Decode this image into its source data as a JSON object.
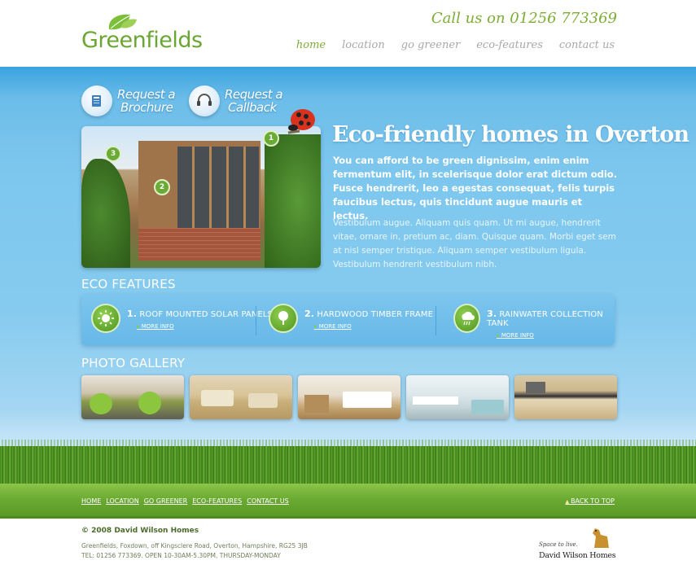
{
  "header": {
    "logo_text": "Greenfields",
    "phone": "Call us on 01256 773369",
    "nav": [
      {
        "label": "home",
        "active": true
      },
      {
        "label": "location",
        "active": false
      },
      {
        "label": "go greener",
        "active": false
      },
      {
        "label": "eco-features",
        "active": false
      },
      {
        "label": "contact us",
        "active": false
      }
    ]
  },
  "cta": {
    "brochure_line1": "Request a",
    "brochure_line2": "Brochure",
    "callback_line1": "Request a",
    "callback_line2": "Callback"
  },
  "hero": {
    "markers": [
      "1",
      "2",
      "3"
    ],
    "headline": "Eco-friendly homes in Overton",
    "lead": "You can afford to be green dignissim, enim enim fermentum elit, in scelerisque dolor erat dictum odio. Fusce hendrerit, leo a egestas consequat, felis turpis faucibus lectus, quis tincidunt augue mauris et lectus.",
    "body": "Vestibulum augue. Aliquam quis quam. Ut mi augue, hendrerit vitae, ornare in, pretium ac, diam. Quisque quam. Morbi eget sem at nisl semper tristique. Aliquam semper vestibulum ligula. Vestibulum hendrerit vestibulum nibh."
  },
  "eco": {
    "title": "ECO FEATURES",
    "items": [
      {
        "num": "1.",
        "label": "ROOF MOUNTED SOLAR PANELS",
        "more": "MORE INFO",
        "icon": "sun-icon"
      },
      {
        "num": "2.",
        "label": "HARDWOOD TIMBER FRAME",
        "more": "MORE INFO",
        "icon": "tree-icon"
      },
      {
        "num": "3.",
        "label": "RAINWATER COLLECTION TANK",
        "more": "MORE INFO",
        "icon": "rain-cloud-icon"
      }
    ]
  },
  "gallery": {
    "title": "PHOTO GALLERY",
    "photos": [
      "dining-room",
      "living-room",
      "bedroom",
      "bathroom",
      "kitchen"
    ]
  },
  "footer": {
    "links": [
      "HOME",
      "LOCATION",
      "GO GREENER",
      "ECO-FEATURES",
      "CONTACT US"
    ],
    "back_to_top": "BACK TO TOP",
    "copyright": "© 2008 David Wilson Homes",
    "address": "Greenfields, Foxdown, off Kingsclere Road, Overton, Hampshire, RG25 3JB",
    "tel": "TEL: 01256 773369. OPEN 10-30AM-5.30PM, THURSDAY-MONDAY",
    "brand_tagline": "Space to live.",
    "brand_name": "David Wilson Homes"
  },
  "colors": {
    "brand_green": "#7bae35",
    "sky_blue": "#7cc6ee"
  }
}
